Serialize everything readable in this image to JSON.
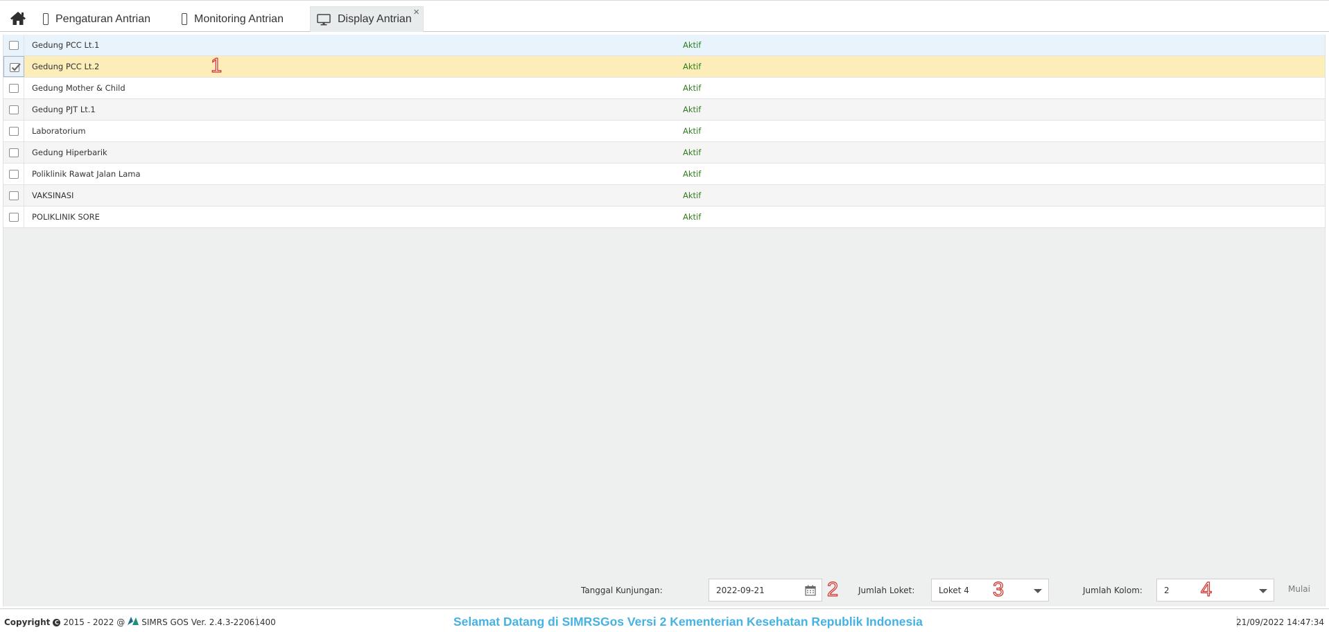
{
  "tabs": [
    {
      "label": "Pengaturan Antrian",
      "icon": "mobile-icon"
    },
    {
      "label": "Monitoring Antrian",
      "icon": "mobile-icon"
    },
    {
      "label": "Display Antrian",
      "icon": "monitor-icon",
      "active": true,
      "close": "×"
    }
  ],
  "grid": {
    "rows": [
      {
        "name": "Gedung PCC Lt.1",
        "status": "Aktif",
        "checked": false
      },
      {
        "name": "Gedung PCC Lt.2",
        "status": "Aktif",
        "checked": true
      },
      {
        "name": "Gedung Mother & Child",
        "status": "Aktif",
        "checked": false
      },
      {
        "name": "Gedung PJT Lt.1",
        "status": "Aktif",
        "checked": false
      },
      {
        "name": "Laboratorium",
        "status": "Aktif",
        "checked": false
      },
      {
        "name": "Gedung Hiperbarik",
        "status": "Aktif",
        "checked": false
      },
      {
        "name": "Poliklinik Rawat Jalan Lama",
        "status": "Aktif",
        "checked": false
      },
      {
        "name": "VAKSINASI",
        "status": "Aktif",
        "checked": false
      },
      {
        "name": "POLIKLINIK SORE",
        "status": "Aktif",
        "checked": false
      }
    ]
  },
  "annotations": [
    "1",
    "2",
    "3",
    "4"
  ],
  "toolbar": {
    "tanggal_label": "Tanggal Kunjungan:",
    "tanggal_value": "2022-09-21",
    "loket_label": "Jumlah Loket:",
    "loket_value": "Loket 4",
    "kolom_label": "Jumlah Kolom:",
    "kolom_value": "2",
    "start_label": "Mulai"
  },
  "footer": {
    "copyright_label": "Copyright",
    "copyright_years": "2015 - 2022 @",
    "version": "SIMRS GOS Ver. 2.4.3-22061400",
    "welcome": "Selamat Datang di SIMRSGos Versi 2 Kementerian Kesehatan Republik Indonesia",
    "datetime": "21/09/2022 14:47:34"
  },
  "colors": {
    "selected_row": "#fdedb9",
    "hovered_row": "#e9f3fb",
    "status_text": "#2e7d1e",
    "welcome_text": "#45b2e4",
    "annotation": "#d2302a"
  }
}
